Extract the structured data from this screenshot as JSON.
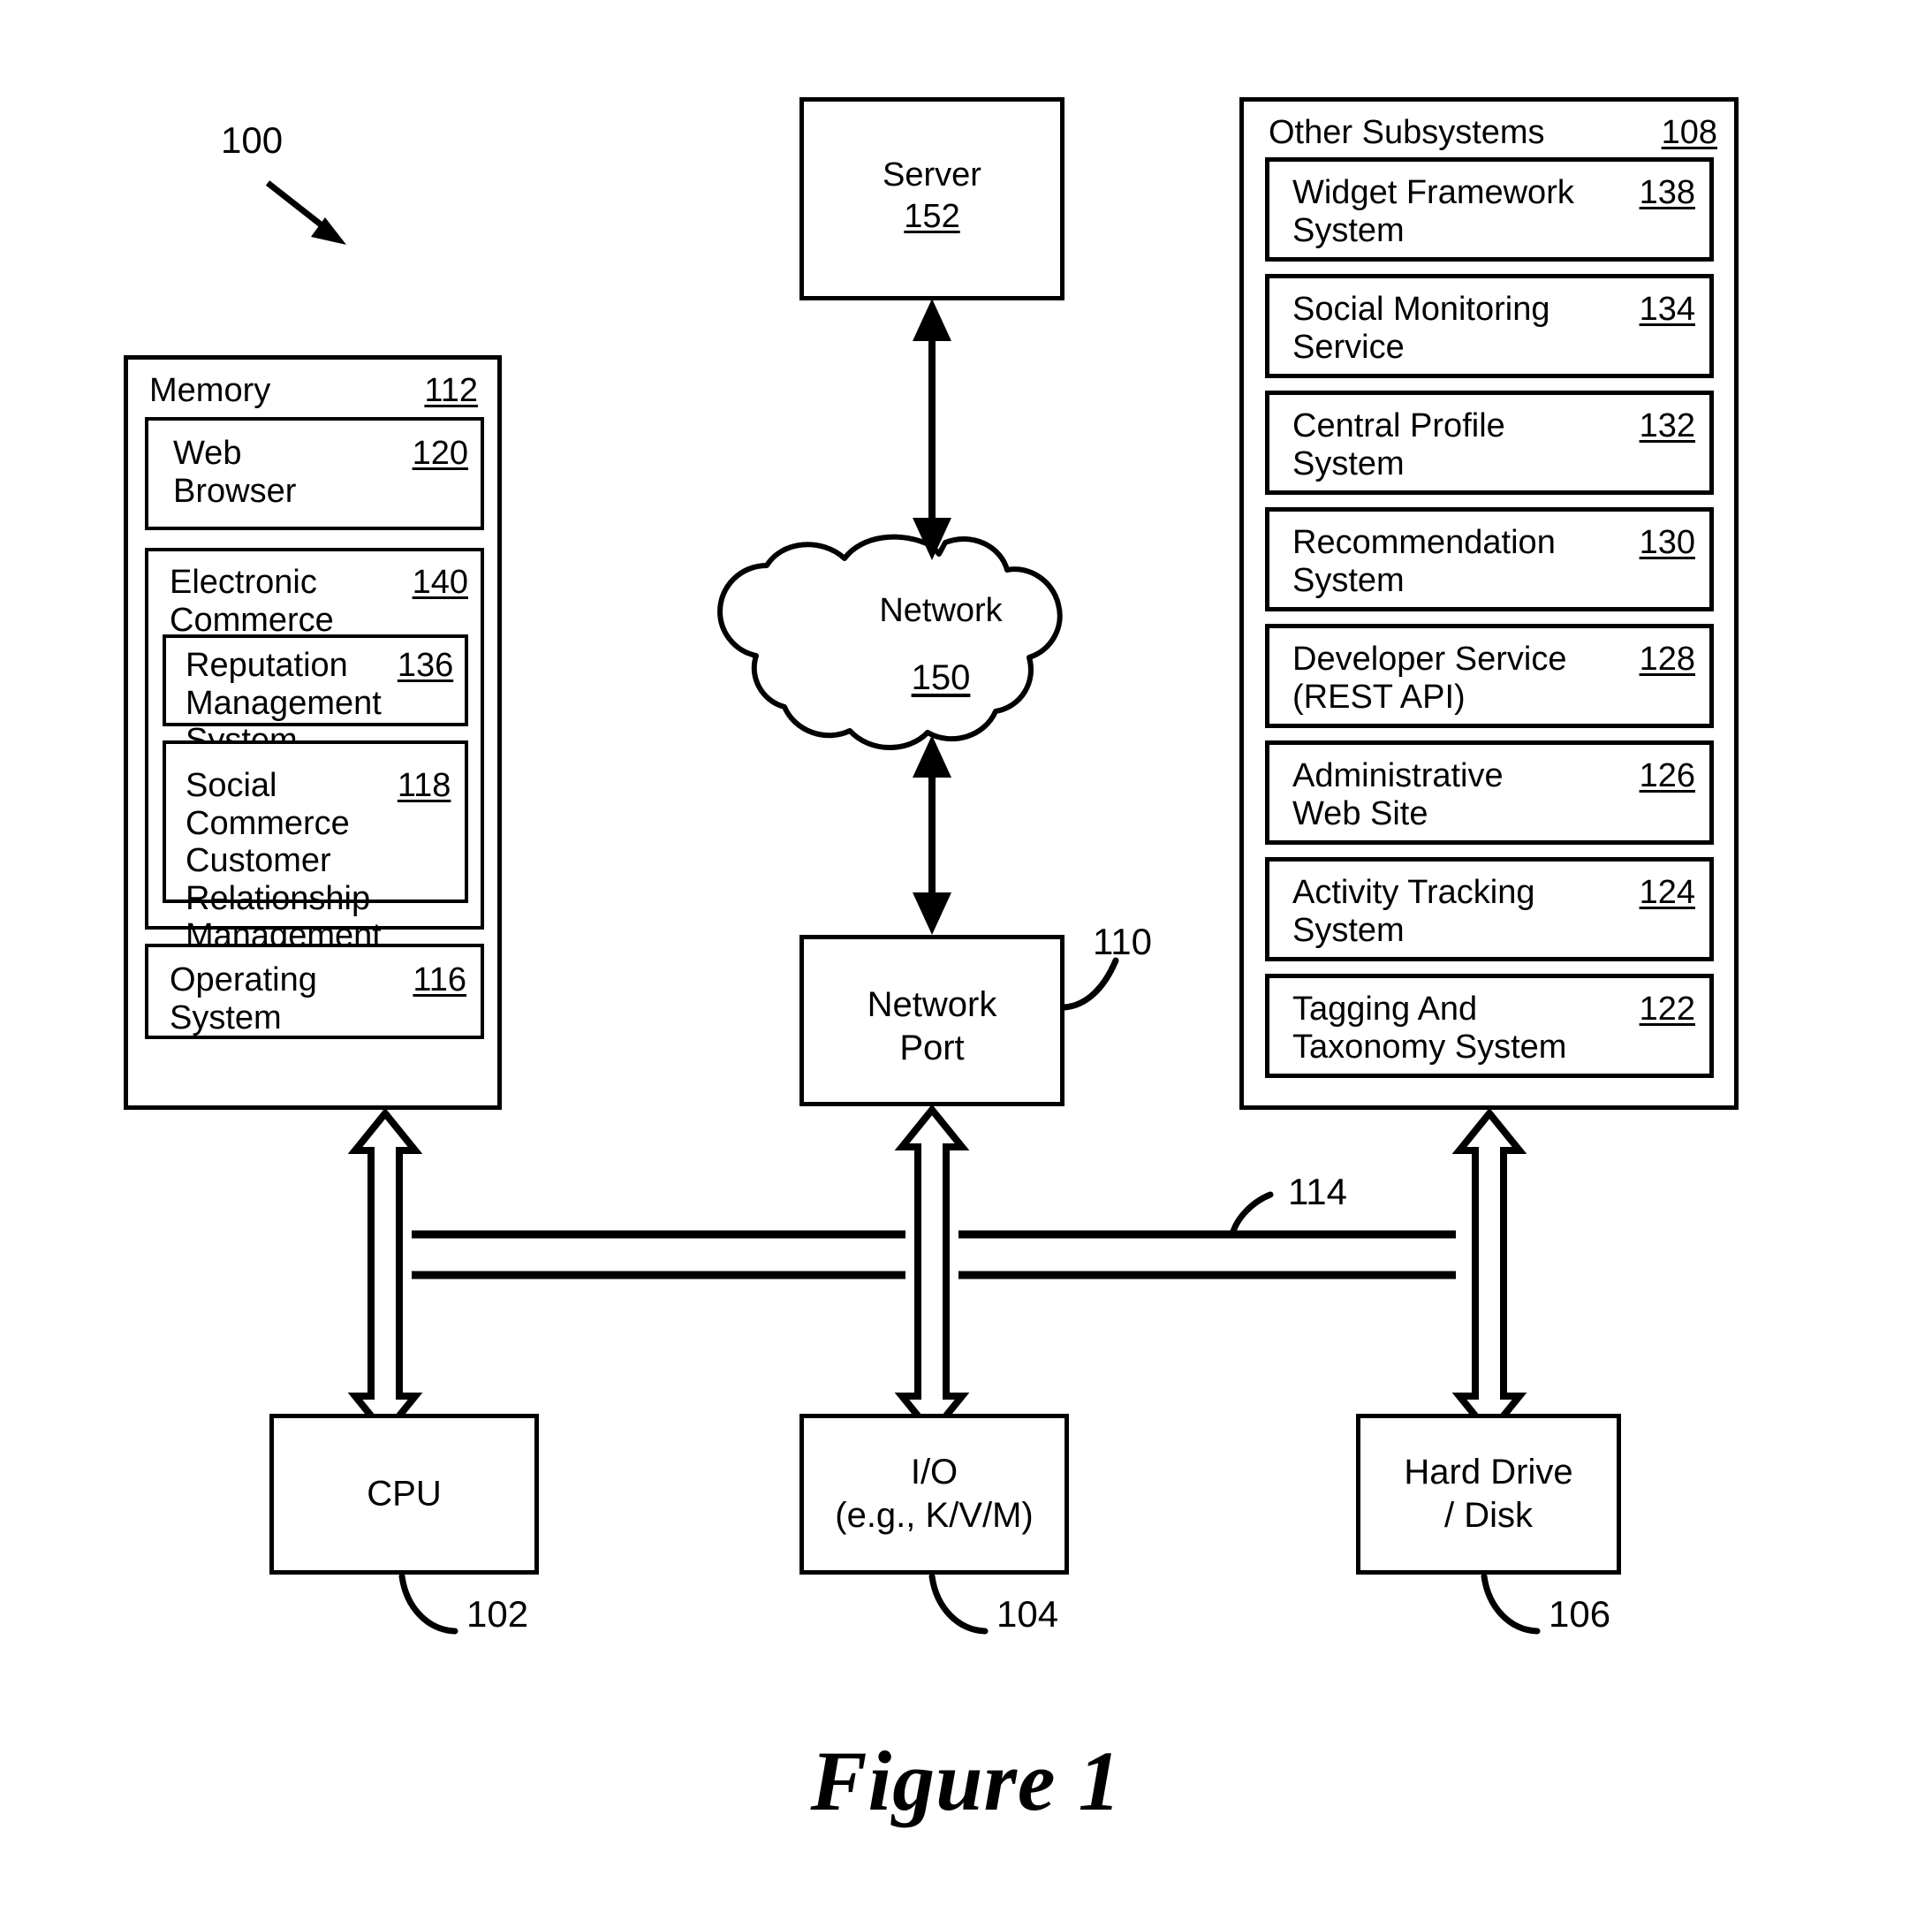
{
  "figure": {
    "caption": "Figure 1",
    "system_ref": "100"
  },
  "memory": {
    "label": "Memory",
    "num": "112",
    "web_browser": {
      "label": "Web\nBrowser",
      "num": "120"
    },
    "ecommerce": {
      "label": "Electronic\nCommerce System",
      "num": "140",
      "reputation": {
        "label": "Reputation\nManagement System",
        "num": "136"
      },
      "crm": {
        "label": "Social Commerce\nCustomer Relationship\nManagement System",
        "num": "118"
      }
    },
    "operating_system": {
      "label": "Operating System",
      "num": "116"
    }
  },
  "subsystems": {
    "label": "Other Subsystems",
    "num": "108",
    "items": [
      {
        "label": "Widget Framework\nSystem",
        "num": "138"
      },
      {
        "label": "Social Monitoring\nService",
        "num": "134"
      },
      {
        "label": "Central Profile\nSystem",
        "num": "132"
      },
      {
        "label": "Recommendation\nSystem",
        "num": "130"
      },
      {
        "label": "Developer Service\n(REST API)",
        "num": "128"
      },
      {
        "label": "Administrative\nWeb Site",
        "num": "126"
      },
      {
        "label": "Activity Tracking\nSystem",
        "num": "124"
      },
      {
        "label": "Tagging And\nTaxonomy System",
        "num": "122"
      }
    ]
  },
  "center": {
    "server": {
      "label": "Server",
      "num": "152"
    },
    "network": {
      "label": "Network",
      "num": "150"
    },
    "network_port": {
      "label": "Network\nPort",
      "num": "110"
    }
  },
  "bottom": {
    "cpu": {
      "label": "CPU",
      "num": "102"
    },
    "io": {
      "label": "I/O\n(e.g., K/V/M)",
      "num": "104"
    },
    "hard_drive": {
      "label": "Hard Drive\n/ Disk",
      "num": "106"
    }
  },
  "bus": {
    "num": "114"
  },
  "colors": {
    "stroke": "#000000",
    "background": "#ffffff"
  }
}
